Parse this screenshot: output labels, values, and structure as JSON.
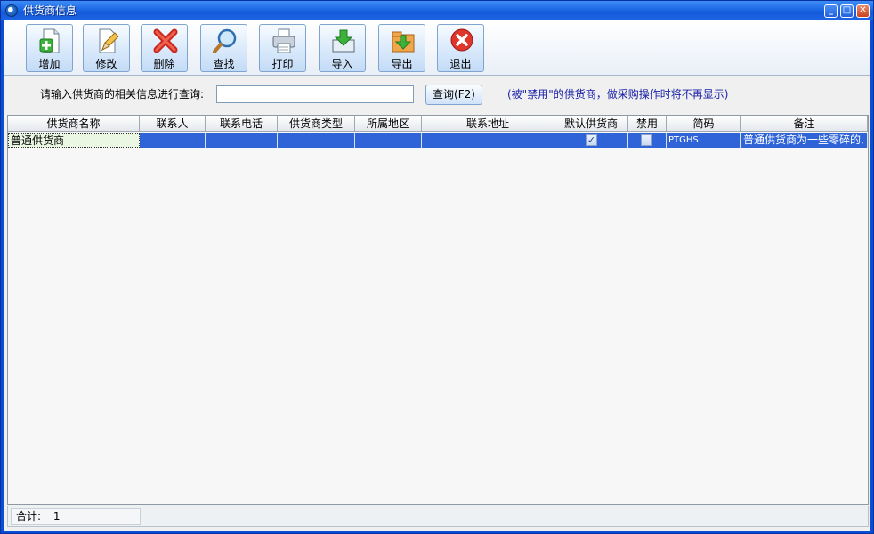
{
  "window": {
    "title": "供货商信息",
    "minimize": "_",
    "maximize": "□",
    "close": "✕"
  },
  "toolbar": {
    "add": "增加",
    "edit": "修改",
    "delete": "删除",
    "find": "查找",
    "print": "打印",
    "import": "导入",
    "export": "导出",
    "exit": "退出"
  },
  "query": {
    "label": "请输入供货商的相关信息进行查询:",
    "value": "",
    "button": "查询(F2)",
    "hint": "(被\"禁用\"的供货商，做采购操作时将不再显示)"
  },
  "table": {
    "columns": [
      "供货商名称",
      "联系人",
      "联系电话",
      "供货商类型",
      "所属地区",
      "联系地址",
      "默认供货商",
      "禁用",
      "简码",
      "备注"
    ],
    "rows": [
      {
        "name": "普通供货商",
        "contact": "",
        "phone": "",
        "type": "",
        "region": "",
        "address": "",
        "default_supplier": true,
        "disabled": false,
        "code": "PTGHS",
        "remark": "普通供货商为一些零碎的,"
      }
    ]
  },
  "status": {
    "total_label": "合计:",
    "total_value": "1"
  },
  "colors": {
    "title_bar": "#1f6ce8",
    "selected_row": "#2f64d8",
    "hint_text": "#1a22a8"
  }
}
